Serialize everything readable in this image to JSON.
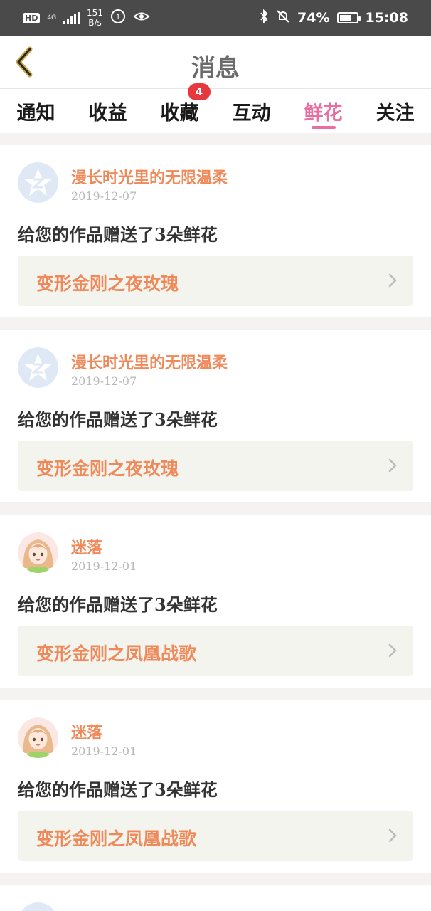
{
  "status_bar": {
    "hd": "HD",
    "network": "4G",
    "speed_value": "151",
    "speed_unit": "B/s",
    "battery": "74%",
    "battery_level": 0.74,
    "time": "15:08"
  },
  "header": {
    "title": "消息",
    "back_icon": "chevron-left-icon"
  },
  "tabs": [
    {
      "label": "通知"
    },
    {
      "label": "收益"
    },
    {
      "label": "收藏",
      "badge": "4"
    },
    {
      "label": "互动"
    },
    {
      "label": "鲜花",
      "active": true
    },
    {
      "label": "关注"
    }
  ],
  "colors": {
    "accent_pink": "#ea6fa0",
    "name_orange": "#f0895a",
    "badge_red": "#e6383e"
  },
  "messages": [
    {
      "avatar": "qzone-star-avatar",
      "username": "漫长时光里的无限温柔",
      "date": "2019-12-07",
      "text": "给您的作品赠送了3朵鲜花",
      "work_title": "变形金刚之夜玫瑰"
    },
    {
      "avatar": "qzone-star-avatar",
      "username": "漫长时光里的无限温柔",
      "date": "2019-12-07",
      "text": "给您的作品赠送了3朵鲜花",
      "work_title": "变形金刚之夜玫瑰"
    },
    {
      "avatar": "anime-girl-avatar",
      "username": "迷落",
      "date": "2019-12-01",
      "text": "给您的作品赠送了3朵鲜花",
      "work_title": "变形金刚之凤凰战歌"
    },
    {
      "avatar": "anime-girl-avatar",
      "username": "迷落",
      "date": "2019-12-01",
      "text": "给您的作品赠送了3朵鲜花",
      "work_title": "变形金刚之凤凰战歌"
    }
  ]
}
